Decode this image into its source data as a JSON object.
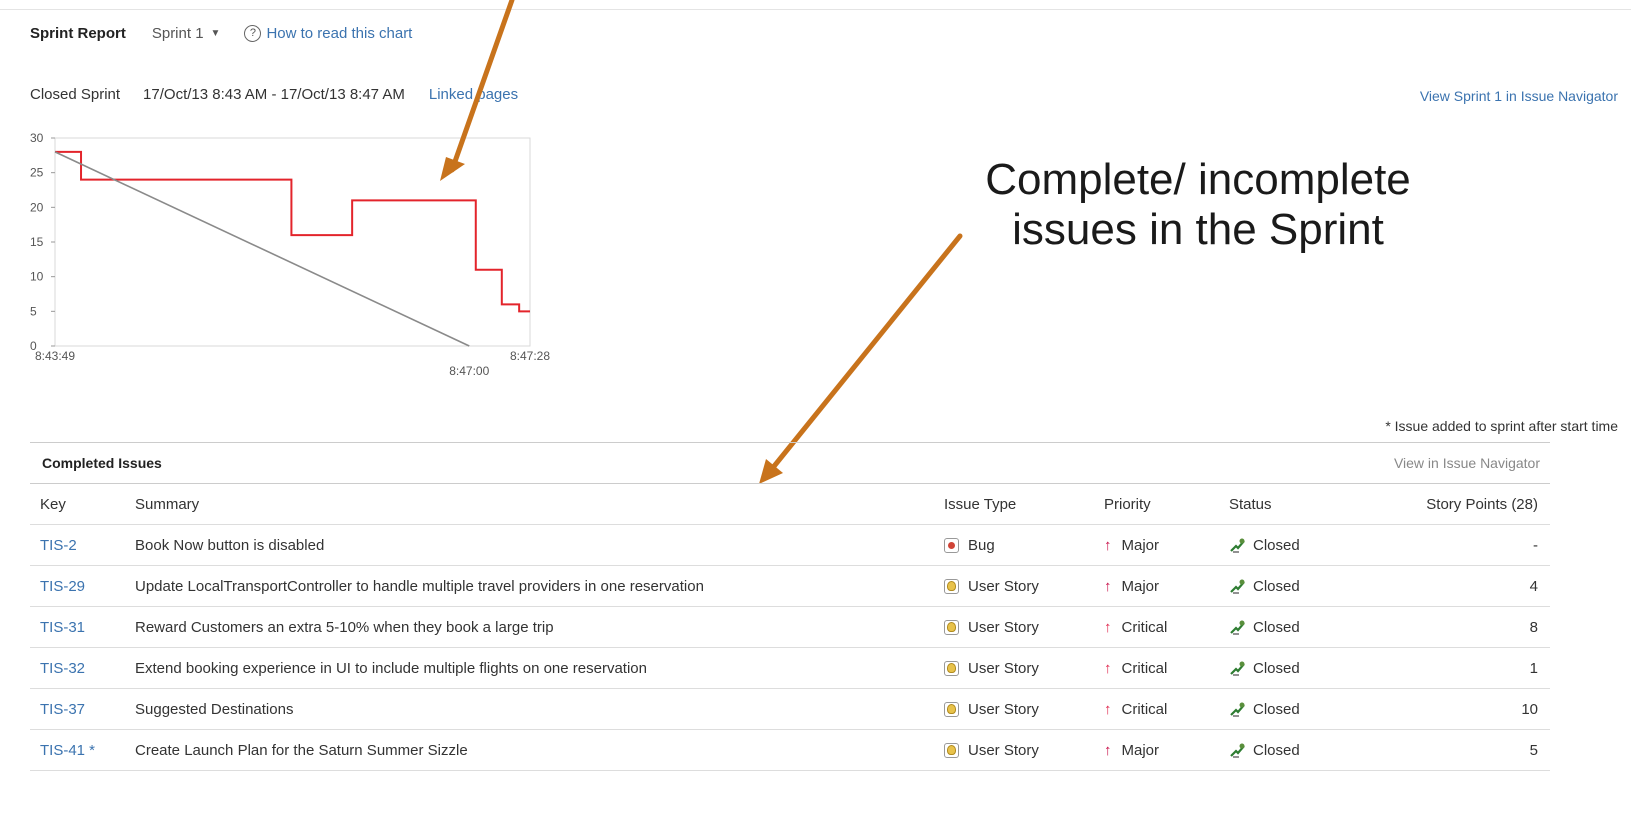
{
  "header": {
    "title": "Sprint Report",
    "sprint_select": "Sprint 1",
    "help_link": "How to read this chart",
    "help_icon": "question-circle-icon"
  },
  "subheader": {
    "state": "Closed Sprint",
    "dates": "17/Oct/13 8:43 AM - 17/Oct/13 8:47 AM",
    "linked_pages": "Linked pages",
    "view_navigator": "View Sprint 1 in Issue Navigator"
  },
  "annotation": {
    "line1": "Complete/ incomplete",
    "line2": "issues in the Sprint",
    "arrow_color": "#c8731c"
  },
  "chart_data": {
    "type": "line",
    "x_tick_labels": [
      "8:43:49",
      "8:47:00",
      "8:47:28"
    ],
    "y_ticks": [
      0,
      5,
      10,
      15,
      20,
      25,
      30
    ],
    "ylim": [
      0,
      30
    ],
    "x_unit": "seconds from 8:43:49",
    "xlim": [
      0,
      219
    ],
    "series": [
      {
        "color": "#e3242b",
        "step": true,
        "points": [
          [
            0,
            28
          ],
          [
            12,
            28
          ],
          [
            12,
            24
          ],
          [
            109,
            24
          ],
          [
            109,
            16
          ],
          [
            137,
            16
          ],
          [
            137,
            21
          ],
          [
            194,
            21
          ],
          [
            194,
            11
          ],
          [
            206,
            11
          ],
          [
            206,
            6
          ],
          [
            214,
            6
          ],
          [
            214,
            5
          ],
          [
            219,
            5
          ]
        ]
      },
      {
        "color": "#8a8a8a",
        "step": false,
        "points": [
          [
            0,
            28
          ],
          [
            191,
            0
          ]
        ]
      }
    ]
  },
  "footnote": "* Issue added to sprint after start time",
  "completed": {
    "title": "Completed Issues",
    "view_link": "View in Issue Navigator",
    "columns": {
      "key": "Key",
      "summary": "Summary",
      "type": "Issue Type",
      "priority": "Priority",
      "status": "Status",
      "points": "Story Points (28)"
    },
    "rows": [
      {
        "key": "TIS-2",
        "summary": "Book Now button is disabled",
        "type": "Bug",
        "type_icon": "bug-icon",
        "priority": "Major",
        "status": "Closed",
        "points": "-"
      },
      {
        "key": "TIS-29",
        "summary": "Update LocalTransportController to handle multiple travel providers in one reservation",
        "type": "User Story",
        "type_icon": "user-story-icon",
        "priority": "Major",
        "status": "Closed",
        "points": "4"
      },
      {
        "key": "TIS-31",
        "summary": "Reward Customers an extra 5-10% when they book a large trip",
        "type": "User Story",
        "type_icon": "user-story-icon",
        "priority": "Critical",
        "status": "Closed",
        "points": "8"
      },
      {
        "key": "TIS-32",
        "summary": "Extend booking experience in UI to include multiple flights on one reservation",
        "type": "User Story",
        "type_icon": "user-story-icon",
        "priority": "Critical",
        "status": "Closed",
        "points": "1"
      },
      {
        "key": "TIS-37",
        "summary": "Suggested Destinations",
        "type": "User Story",
        "type_icon": "user-story-icon",
        "priority": "Critical",
        "status": "Closed",
        "points": "10"
      },
      {
        "key": "TIS-41 *",
        "summary": "Create Launch Plan for the Saturn Summer Sizzle",
        "type": "User Story",
        "type_icon": "user-story-icon",
        "priority": "Major",
        "status": "Closed",
        "points": "5"
      }
    ]
  }
}
